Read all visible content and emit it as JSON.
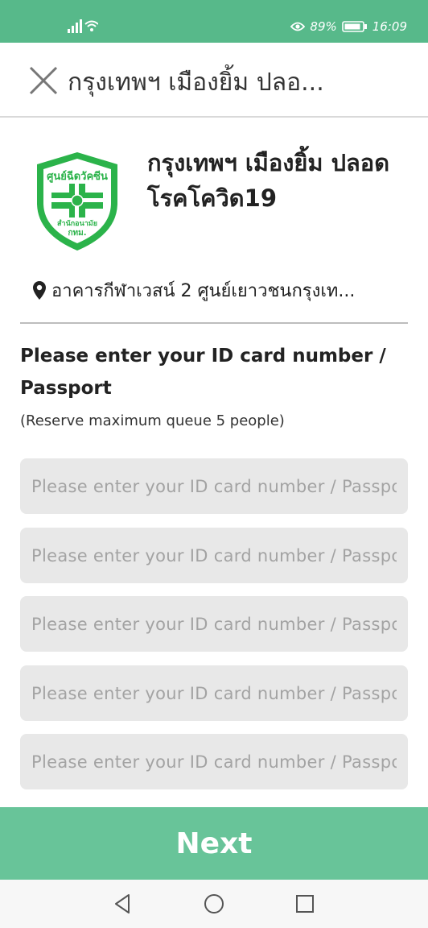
{
  "status_bar": {
    "battery": "89%",
    "time": "16:09",
    "icons": [
      "signal-icon",
      "wifi-icon",
      "eye-icon",
      "battery-icon"
    ]
  },
  "header": {
    "title": "กรุงเทพฯ เมืองยิ้ม ปลอ...",
    "close_icon": "close-icon"
  },
  "center": {
    "logo_text_top": "ศูนย์ฉีดวัคซีน",
    "logo_text_bottom": "สำนักอนามัย",
    "logo_text_org": "กทม.",
    "name": "กรุงเทพฯ เมืองยิ้ม ปลอด โรคโควิด19",
    "location_icon": "map-pin-icon",
    "location": "อาคารกีฬาเวสน์ 2 ศูนย์เยาวชนกรุงเท..."
  },
  "form": {
    "prompt": "Please enter your ID card number / Passport",
    "note": "(Reserve maximum queue 5 people)",
    "fields": [
      {
        "value": "",
        "placeholder": "Please enter your ID card number / Passport"
      },
      {
        "value": "",
        "placeholder": "Please enter your ID card number / Passport"
      },
      {
        "value": "",
        "placeholder": "Please enter your ID card number / Passport"
      },
      {
        "value": "",
        "placeholder": "Please enter your ID card number / Passport"
      },
      {
        "value": "",
        "placeholder": "Please enter your ID card number / Passport"
      }
    ]
  },
  "actions": {
    "next_label": "Next"
  },
  "nav_bar": {
    "icons": [
      "back-icon",
      "home-icon",
      "recents-icon"
    ]
  },
  "colors": {
    "status_bar": "#57b98a",
    "primary_button": "#68c499",
    "field_bg": "#e8e8e8",
    "logo_green": "#2bb34a"
  }
}
